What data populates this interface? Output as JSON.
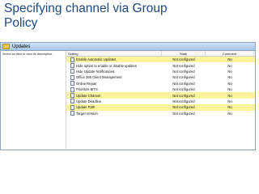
{
  "slide": {
    "title": "Specifying channel via Group\nPolicy"
  },
  "window": {
    "folder_label": "Updates",
    "description_prompt": "Select an item to view its description.",
    "columns": {
      "setting": "Setting",
      "state": "State",
      "comment": "Comment"
    },
    "rows": [
      {
        "setting": "Enable Automatic Updates",
        "state": "Not configured",
        "comment": "No",
        "highlighted": true
      },
      {
        "setting": "Hide option to enable or disable updates",
        "state": "Not configured",
        "comment": "No",
        "highlighted": false
      },
      {
        "setting": "Hide Update Notifications",
        "state": "Not configured",
        "comment": "No",
        "highlighted": false
      },
      {
        "setting": "Office 365 Client Management",
        "state": "Not configured",
        "comment": "No",
        "highlighted": false
      },
      {
        "setting": "Online Repair",
        "state": "Not configured",
        "comment": "No",
        "highlighted": false
      },
      {
        "setting": "Prioritize BITS",
        "state": "Not configured",
        "comment": "No",
        "highlighted": false
      },
      {
        "setting": "Update Channel",
        "state": "Not configured",
        "comment": "No",
        "highlighted": true
      },
      {
        "setting": "Update Deadline",
        "state": "Not configured",
        "comment": "No",
        "highlighted": false
      },
      {
        "setting": "Update Path",
        "state": "Not configured",
        "comment": "No",
        "highlighted": true
      },
      {
        "setting": "Target Version",
        "state": "Not configured",
        "comment": "No",
        "highlighted": false
      }
    ]
  }
}
